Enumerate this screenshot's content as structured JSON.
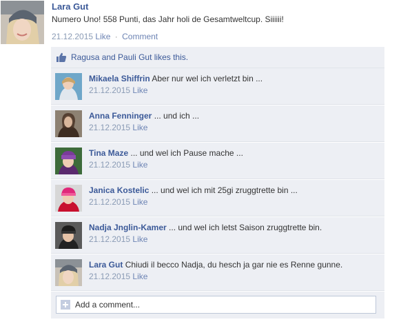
{
  "post": {
    "author": "Lara Gut",
    "text": "Numero Uno! 558 Punti, das Jahr holi de Gesamtweltcup. Siiiiii!",
    "date": "21.12.2015",
    "like_label": "Like",
    "separator": "·",
    "comment_label": "Comment"
  },
  "likes": {
    "text": "Ragusa and Pauli Gut likes this."
  },
  "comments": [
    {
      "name": "Mikaela Shiffrin",
      "text": "Aber nur wel ich verletzt bin ...",
      "date": "21.12.2015",
      "like": "Like"
    },
    {
      "name": "Anna Fenninger",
      "text": "... und ich ...",
      "date": "21.12.2015",
      "like": "Like"
    },
    {
      "name": "Tina Maze",
      "text": "... und wel ich Pause mache ...",
      "date": "21.12.2015",
      "like": "Like"
    },
    {
      "name": "Janica Kostelic",
      "text": "... und wel ich mit 25gi zruggtrette bin ...",
      "date": "21.12.2015",
      "like": "Like"
    },
    {
      "name": "Nadja Jnglin-Kamer",
      "text": "... und wel ich letst Saison zruggtrette bin.",
      "date": "21.12.2015",
      "like": "Like"
    },
    {
      "name": "Lara Gut",
      "text": "Chiudi il becco Nadja, du hesch ja gar nie es Renne gunne.",
      "date": "21.12.2015",
      "like": "Like"
    }
  ],
  "add_comment": {
    "placeholder": "Add a comment..."
  },
  "icons": {
    "like": "thumbs-up-icon",
    "add": "plus-icon"
  },
  "colors": {
    "link": "#3b5998",
    "meta": "#8a9bb5",
    "thread_bg": "#edeff4"
  }
}
